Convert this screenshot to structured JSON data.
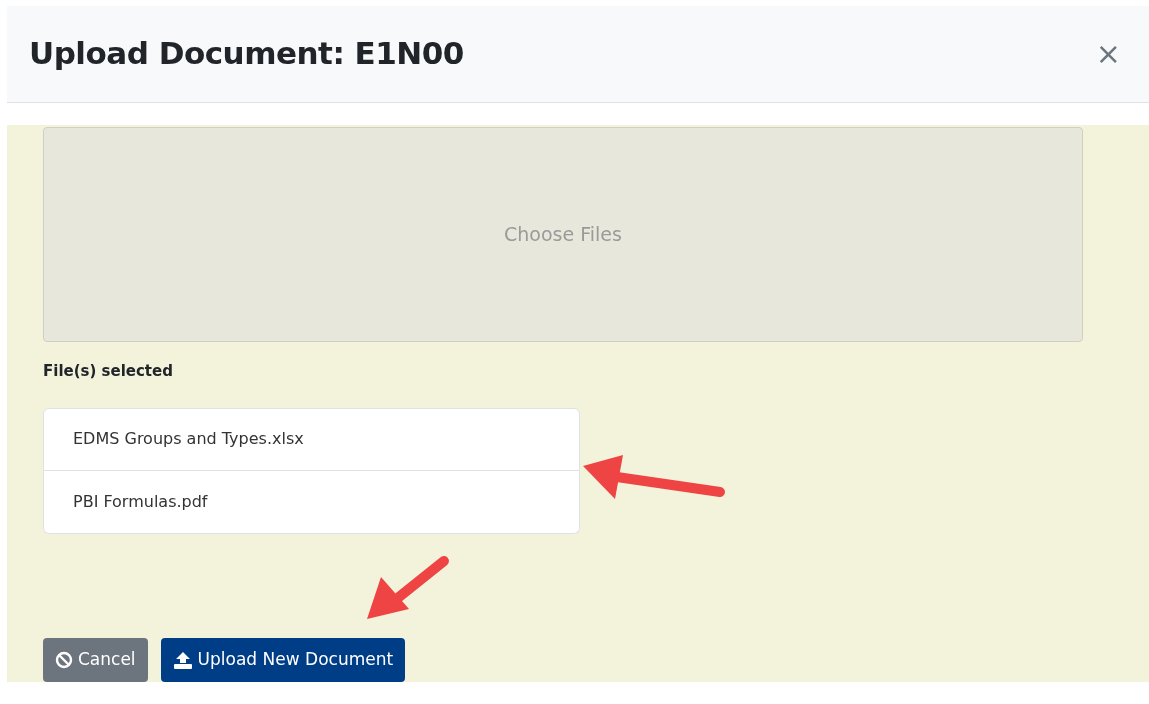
{
  "dialog": {
    "title": "Upload Document: E1N00",
    "close": "×"
  },
  "dropzone": {
    "label": "Choose Files"
  },
  "selected_heading": "File(s) selected",
  "files": [
    {
      "name": "EDMS Groups and Types.xlsx"
    },
    {
      "name": "PBI Formulas.pdf"
    }
  ],
  "buttons": [
    {
      "kind": "cancel",
      "label": "Cancel"
    },
    {
      "kind": "upload",
      "label": "Upload New Document"
    }
  ]
}
